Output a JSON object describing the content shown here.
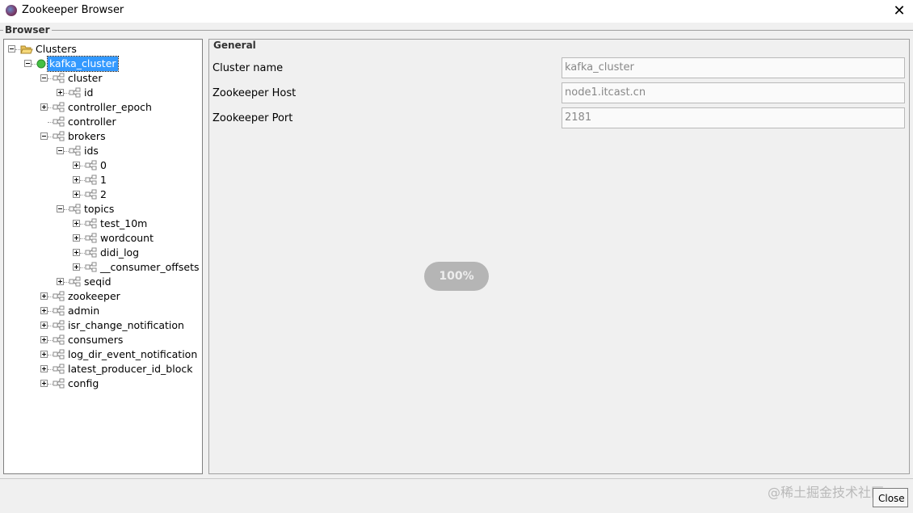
{
  "window": {
    "title": "Zookeeper Browser"
  },
  "browser": {
    "label": "Browser"
  },
  "tree": {
    "nodes": [
      {
        "label": "Clusters",
        "depth": 0,
        "expander": "minus",
        "icon": "folder-open-icon"
      },
      {
        "label": "kafka_cluster",
        "depth": 1,
        "expander": "minus",
        "icon": "status-dot-icon",
        "selected": true
      },
      {
        "label": "cluster",
        "depth": 2,
        "expander": "minus",
        "icon": "znode-icon"
      },
      {
        "label": "id",
        "depth": 3,
        "expander": "plus",
        "icon": "znode-icon"
      },
      {
        "label": "controller_epoch",
        "depth": 2,
        "expander": "plus",
        "icon": "znode-icon"
      },
      {
        "label": "controller",
        "depth": 2,
        "expander": "none",
        "icon": "znode-icon"
      },
      {
        "label": "brokers",
        "depth": 2,
        "expander": "minus",
        "icon": "znode-icon"
      },
      {
        "label": "ids",
        "depth": 3,
        "expander": "minus",
        "icon": "znode-icon"
      },
      {
        "label": "0",
        "depth": 4,
        "expander": "plus",
        "icon": "znode-icon"
      },
      {
        "label": "1",
        "depth": 4,
        "expander": "plus",
        "icon": "znode-icon"
      },
      {
        "label": "2",
        "depth": 4,
        "expander": "plus",
        "icon": "znode-icon"
      },
      {
        "label": "topics",
        "depth": 3,
        "expander": "minus",
        "icon": "znode-icon"
      },
      {
        "label": "test_10m",
        "depth": 4,
        "expander": "plus",
        "icon": "znode-icon"
      },
      {
        "label": "wordcount",
        "depth": 4,
        "expander": "plus",
        "icon": "znode-icon"
      },
      {
        "label": "didi_log",
        "depth": 4,
        "expander": "plus",
        "icon": "znode-icon"
      },
      {
        "label": "__consumer_offsets",
        "depth": 4,
        "expander": "plus",
        "icon": "znode-icon"
      },
      {
        "label": "seqid",
        "depth": 3,
        "expander": "plus",
        "icon": "znode-icon"
      },
      {
        "label": "zookeeper",
        "depth": 2,
        "expander": "plus",
        "icon": "znode-icon"
      },
      {
        "label": "admin",
        "depth": 2,
        "expander": "plus",
        "icon": "znode-icon"
      },
      {
        "label": "isr_change_notification",
        "depth": 2,
        "expander": "plus",
        "icon": "znode-icon"
      },
      {
        "label": "consumers",
        "depth": 2,
        "expander": "plus",
        "icon": "znode-icon"
      },
      {
        "label": "log_dir_event_notification",
        "depth": 2,
        "expander": "plus",
        "icon": "znode-icon"
      },
      {
        "label": "latest_producer_id_block",
        "depth": 2,
        "expander": "plus",
        "icon": "znode-icon"
      },
      {
        "label": "config",
        "depth": 2,
        "expander": "plus",
        "icon": "znode-icon"
      }
    ]
  },
  "general": {
    "label": "General",
    "fields": [
      {
        "label": "Cluster name",
        "value": "kafka_cluster"
      },
      {
        "label": "Zookeeper Host",
        "value": "node1.itcast.cn"
      },
      {
        "label": "Zookeeper Port",
        "value": "2181"
      }
    ]
  },
  "progress": {
    "text": "100%"
  },
  "footer": {
    "watermark": "@稀土掘金技术社区",
    "close_label": "Close"
  },
  "colors": {
    "selection": "#3399ff",
    "status_dot": "#44c044"
  }
}
